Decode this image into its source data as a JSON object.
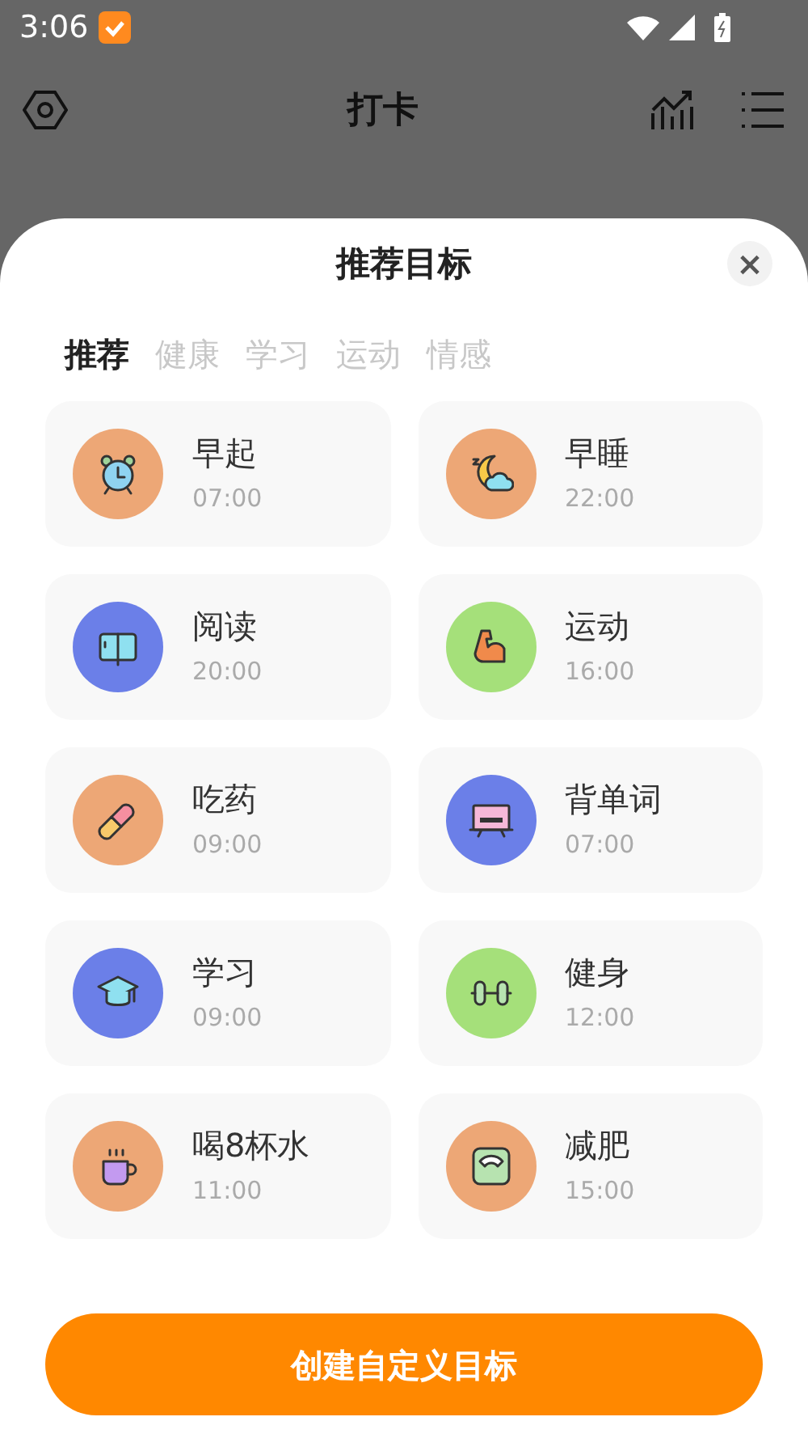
{
  "status_bar": {
    "time": "3:06"
  },
  "header": {
    "title": "打卡"
  },
  "sheet": {
    "title": "推荐目标",
    "close": "×",
    "tabs": [
      {
        "label": "推荐",
        "selected": true
      },
      {
        "label": "健康",
        "selected": false
      },
      {
        "label": "学习",
        "selected": false
      },
      {
        "label": "运动",
        "selected": false
      },
      {
        "label": "情感",
        "selected": false
      }
    ],
    "goals": [
      {
        "name": "早起",
        "time": "07:00",
        "color": "#eda776"
      },
      {
        "name": "早睡",
        "time": "22:00",
        "color": "#eda776"
      },
      {
        "name": "阅读",
        "time": "20:00",
        "color": "#6b7fe8"
      },
      {
        "name": "运动",
        "time": "16:00",
        "color": "#a5e07a"
      },
      {
        "name": "吃药",
        "time": "09:00",
        "color": "#eda776"
      },
      {
        "name": "背单词",
        "time": "07:00",
        "color": "#6b7fe8"
      },
      {
        "name": "学习",
        "time": "09:00",
        "color": "#6b7fe8"
      },
      {
        "name": "健身",
        "time": "12:00",
        "color": "#a5e07a"
      },
      {
        "name": "喝8杯水",
        "time": "11:00",
        "color": "#eda776"
      },
      {
        "name": "减肥",
        "time": "15:00",
        "color": "#eda776"
      }
    ],
    "create_button": "创建自定义目标"
  }
}
